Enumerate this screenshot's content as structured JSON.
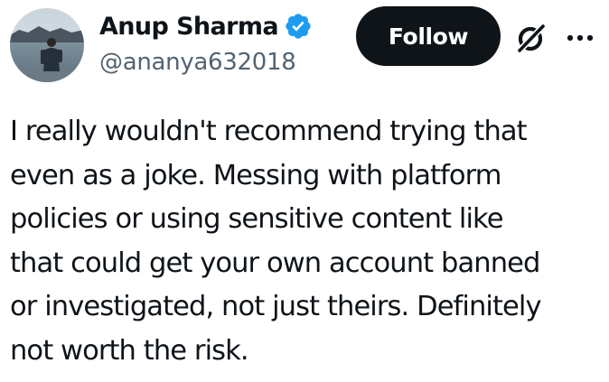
{
  "author": {
    "display_name": "Anup Sharma",
    "handle": "@ananya632018",
    "verified": true
  },
  "actions": {
    "follow_label": "Follow"
  },
  "icons": {
    "verified": "verified-badge-icon",
    "grok": "grok-icon",
    "more": "more-horizontal-icon"
  },
  "tweet": {
    "text": "I really wouldn't recommend trying that\neven as a joke. Messing with platform\npolicies or using sensitive content like\nthat could get your own account banned\nor investigated, not just theirs. Definitely\nnot worth the risk."
  },
  "colors": {
    "text_primary": "#0f1419",
    "text_secondary": "#536471",
    "verified_blue": "#1d9bf0",
    "follow_bg": "#0f1419",
    "follow_text": "#ffffff"
  }
}
